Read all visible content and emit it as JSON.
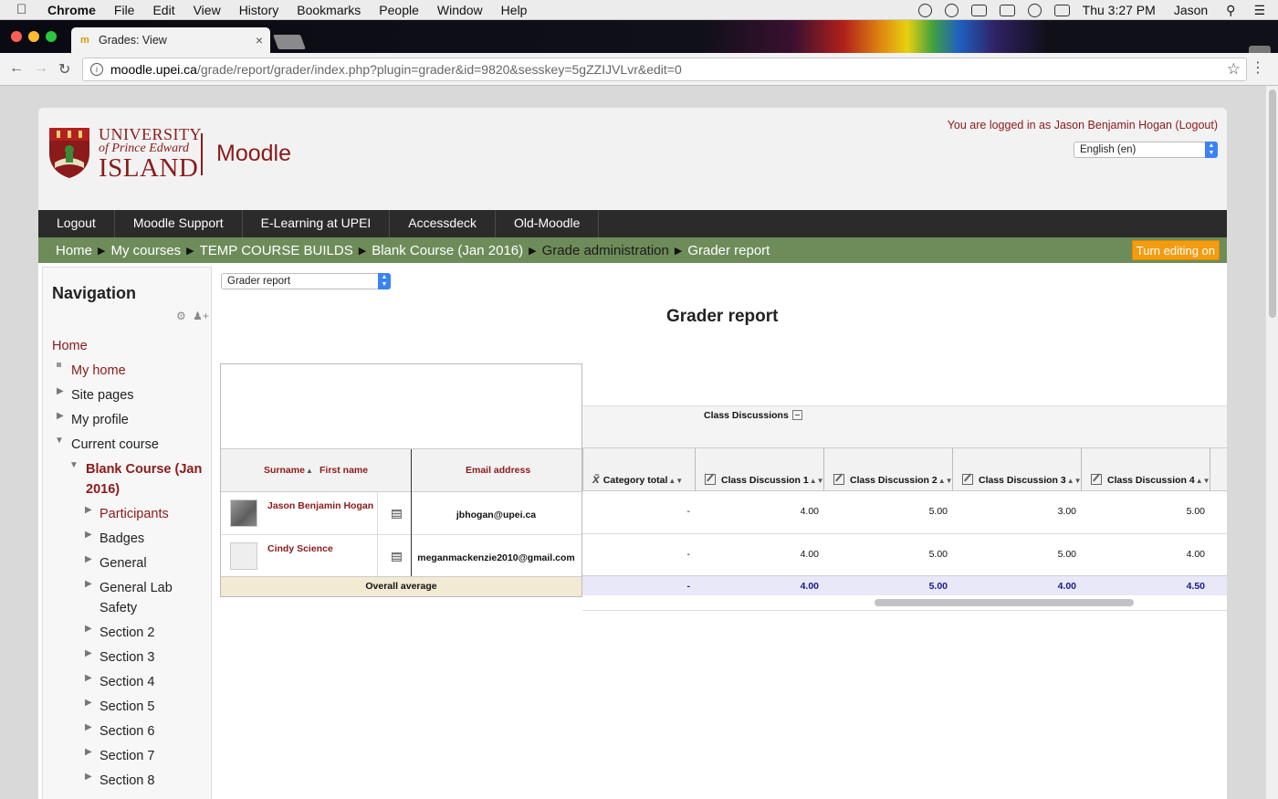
{
  "os_menu": {
    "app": "Chrome",
    "items": [
      "File",
      "Edit",
      "View",
      "History",
      "Bookmarks",
      "People",
      "Window",
      "Help"
    ],
    "clock": "Thu 3:27 PM",
    "user": "Jason"
  },
  "browser": {
    "tab_title": "Grades: View",
    "url_domain": "moodle.upei.ca",
    "url_path": "/grade/report/grader/index.php?plugin=grader&id=9820&sesskey=5gZZIJVLvr&edit=0"
  },
  "header": {
    "logo_line1": "UNIVERSITY",
    "logo_line2": "of Prince Edward",
    "logo_line3": "ISLAND",
    "site_name": "Moodle",
    "logged_in": "You are logged in as Jason Benjamin Hogan (Logout)",
    "language": "English (en)"
  },
  "topnav": [
    "Logout",
    "Moodle Support",
    "E-Learning at UPEI",
    "Accessdeck",
    "Old-Moodle"
  ],
  "breadcrumb": [
    "Home",
    "My courses",
    "TEMP COURSE BUILDS",
    "Blank Course (Jan 2016)",
    "Grade administration",
    "Grader report"
  ],
  "edit_button": "Turn editing on",
  "navigation": {
    "title": "Navigation",
    "items": {
      "home": "Home",
      "my_home": "My home",
      "site_pages": "Site pages",
      "my_profile": "My profile",
      "current_course": "Current course",
      "course_line1": "Blank Course (Jan",
      "course_line2": "2016)",
      "participants": "Participants",
      "badges": "Badges",
      "general": "General",
      "gen_lab1": "General Lab",
      "gen_lab2": "Safety",
      "s2": "Section 2",
      "s3": "Section 3",
      "s4": "Section 4",
      "s5": "Section 5",
      "s6": "Section 6",
      "s7": "Section 7",
      "s8": "Section 8"
    }
  },
  "report": {
    "selector": "Grader report",
    "title": "Grader report",
    "category": "Class Discussions",
    "col_surname": "Surname",
    "col_firstname": "First name",
    "col_email": "Email address",
    "col_category_total": "Category total",
    "columns": [
      "Class Discussion 1",
      "Class Discussion 2",
      "Class Discussion 3",
      "Class Discussion 4"
    ],
    "rows": [
      {
        "name": "Jason Benjamin Hogan",
        "email": "jbhogan@upei.ca",
        "total": "-",
        "grades": [
          "4.00",
          "5.00",
          "3.00",
          "5.00"
        ]
      },
      {
        "name": "Cindy Science",
        "email": "meganmackenzie2010@gmail.com",
        "total": "-",
        "grades": [
          "4.00",
          "5.00",
          "5.00",
          "4.00"
        ]
      }
    ],
    "overall_label": "Overall average",
    "overall": {
      "total": "-",
      "grades": [
        "4.00",
        "5.00",
        "4.00",
        "4.50"
      ]
    }
  }
}
